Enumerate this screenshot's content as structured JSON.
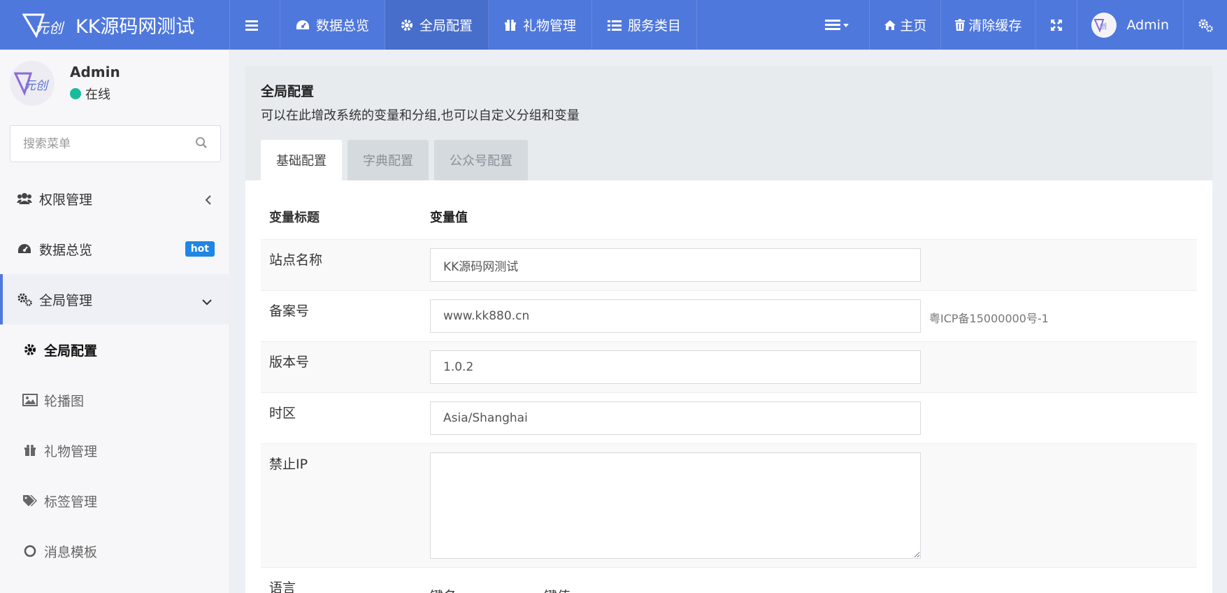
{
  "brand": {
    "title": "KK源码网测试"
  },
  "header": {
    "nav": [
      {
        "label": "数据总览",
        "icon": "dashboard-icon"
      },
      {
        "label": "全局配置",
        "icon": "gear-icon"
      },
      {
        "label": "礼物管理",
        "icon": "gift-icon"
      },
      {
        "label": "服务类目",
        "icon": "list-icon"
      }
    ],
    "right": {
      "home": "主页",
      "clear_cache": "清除缓存",
      "user": "Admin"
    }
  },
  "sidebar": {
    "user": {
      "name": "Admin",
      "status": "在线"
    },
    "search": {
      "placeholder": "搜索菜单"
    },
    "menu": [
      {
        "label": "权限管理",
        "icon": "users-icon"
      },
      {
        "label": "数据总览",
        "icon": "dashboard-icon",
        "badge": "hot"
      },
      {
        "label": "全局管理",
        "icon": "gears-icon"
      }
    ],
    "submenu": [
      {
        "label": "全局配置",
        "icon": "gear-icon"
      },
      {
        "label": "轮播图",
        "icon": "image-icon"
      },
      {
        "label": "礼物管理",
        "icon": "gift-icon"
      },
      {
        "label": "标签管理",
        "icon": "tags-icon"
      },
      {
        "label": "消息模板",
        "icon": "circle-icon"
      }
    ]
  },
  "content": {
    "title": "全局配置",
    "description": "可以在此增改系统的变量和分组,也可以自定义分组和变量",
    "tabs": [
      "基础配置",
      "字典配置",
      "公众号配置"
    ],
    "table": {
      "header_title": "变量标题",
      "header_value": "变量值",
      "rows": [
        {
          "title": "站点名称",
          "value": "KK源码网测试"
        },
        {
          "title": "备案号",
          "value": "www.kk880.cn",
          "tip": "粤ICP备15000000号-1"
        },
        {
          "title": "版本号",
          "value": "1.0.2"
        },
        {
          "title": "时区",
          "value": "Asia/Shanghai"
        },
        {
          "title": "禁止IP",
          "value": ""
        },
        {
          "title": "语言",
          "key_label": "键名",
          "value_label": "键值"
        }
      ]
    }
  },
  "colors": {
    "header_bg": "#4f78dd",
    "online": "#18bc9c",
    "badge_hot": "#1f86e4"
  }
}
